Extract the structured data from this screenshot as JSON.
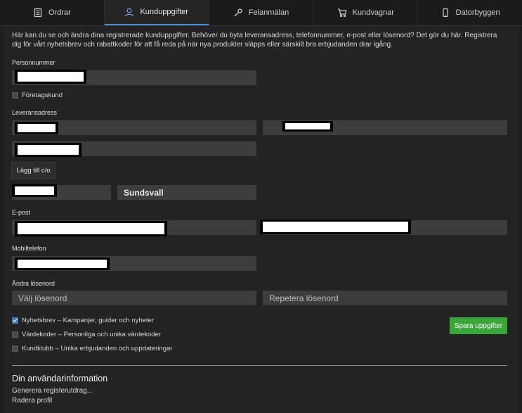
{
  "tabs": [
    {
      "label": "Ordrar",
      "icon": "document-icon"
    },
    {
      "label": "Kunduppgifter",
      "icon": "user-icon",
      "active": true
    },
    {
      "label": "Felanmälan",
      "icon": "wrench-icon"
    },
    {
      "label": "Kundvagnar",
      "icon": "cart-icon"
    },
    {
      "label": "Datorbyggen",
      "icon": "phone-icon"
    }
  ],
  "intro": "Här kan du se och ändra dina registrerade kunduppgifter. Behöver du byta leveransadress, telefonnummer, e-post eller lösenord? Det gör du här. Registrera dig för vårt nyhetsbrev och rabattkoder för att få reda på när nya produkter släpps eller särskilt bra erbjudanden drar igång.",
  "labels": {
    "personnummer": "Personnummer",
    "foretagskund": "Företagskund",
    "leveransadress": "Leveransadress",
    "epost": "E-post",
    "mobiltelefon": "Mobiltelefon",
    "andra_losenord": "Ändra lösenord"
  },
  "fields": {
    "city": "Sundsvall",
    "password_placeholder": "Välj lösenord",
    "repeat_password_placeholder": "Repetera lösenord"
  },
  "buttons": {
    "add_co": "Lägg till c/o",
    "save": "Spara uppgifter"
  },
  "checkboxes": [
    {
      "label": "Nyhetsbrev – Kampanjer, guider och nyheter",
      "checked": true
    },
    {
      "label": "Värdekoder – Personliga och unika värdekoder",
      "checked": false
    },
    {
      "label": "Kundklubb – Unika erbjudanden och uppdateringar",
      "checked": false
    }
  ],
  "user_info": {
    "title": "Din användarinformation",
    "links": [
      "Generera registerutdrag...",
      "Radera profil"
    ]
  },
  "colors": {
    "accent": "#4a90d9",
    "save_button": "#3aa63a",
    "field_bg": "#3d3d3d"
  }
}
